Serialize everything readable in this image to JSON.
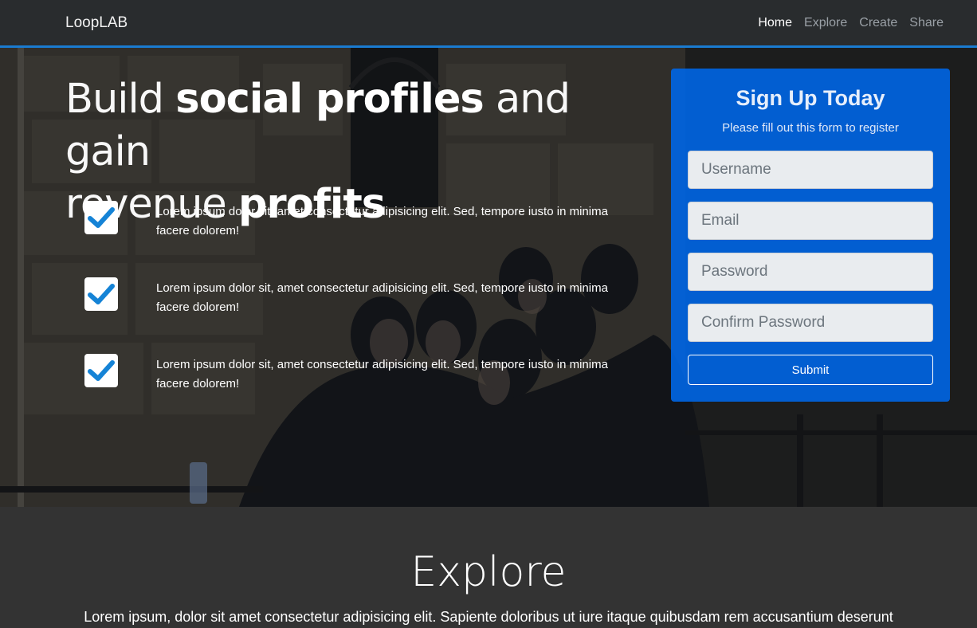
{
  "navbar": {
    "brand": "LoopLAB",
    "links": [
      {
        "label": "Home",
        "active": true
      },
      {
        "label": "Explore",
        "active": false
      },
      {
        "label": "Create",
        "active": false
      },
      {
        "label": "Share",
        "active": false
      }
    ]
  },
  "hero": {
    "headline": {
      "part1": "Build ",
      "bold1": "social profiles",
      "part2": " and gain",
      "part3": "revenue ",
      "bold2": "profits"
    },
    "features": [
      {
        "icon": "check-icon",
        "text": "Lorem ipsum dolor sit, amet consectetur adipisicing elit. Sed, tempore iusto in minima facere dolorem!"
      },
      {
        "icon": "check-icon",
        "text": "Lorem ipsum dolor sit, amet consectetur adipisicing elit. Sed, tempore iusto in minima facere dolorem!"
      },
      {
        "icon": "check-icon",
        "text": "Lorem ipsum dolor sit, amet consectetur adipisicing elit. Sed, tempore iusto in minima facere dolorem!"
      }
    ]
  },
  "signup": {
    "title": "Sign Up Today",
    "subtitle": "Please fill out this form to register",
    "fields": {
      "username": {
        "placeholder": "Username",
        "value": ""
      },
      "email": {
        "placeholder": "Email",
        "value": ""
      },
      "password": {
        "placeholder": "Password",
        "value": ""
      },
      "confirm": {
        "placeholder": "Confirm Password",
        "value": ""
      }
    },
    "submit_label": "Submit"
  },
  "explore": {
    "title": "Explore",
    "text": "Lorem ipsum, dolor sit amet consectetur adipisicing elit. Sapiente doloribus ut iure itaque quibusdam rem accusantium deserunt"
  },
  "colors": {
    "accent": "#1a7bd0",
    "card": "#0066e6",
    "section_bg": "#333333"
  }
}
